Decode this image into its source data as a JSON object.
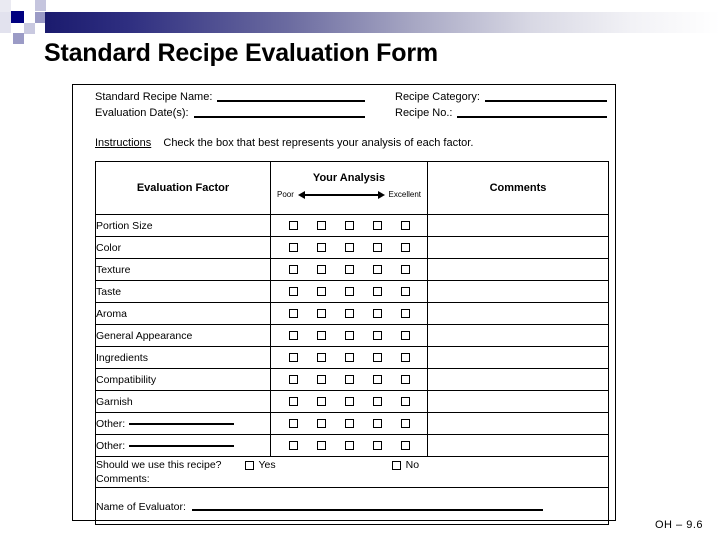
{
  "title": "Standard Recipe Evaluation Form",
  "decor": {
    "navy": "#000080",
    "lavender": "#b8b8d8",
    "pale": "#d8d8e8",
    "gradient_start": "#1b1b6e",
    "gradient_end": "#ffffff"
  },
  "top_fields": {
    "recipe_name_label": "Standard Recipe Name:",
    "evaluation_date_label": "Evaluation Date(s):",
    "recipe_category_label": "Recipe Category:",
    "recipe_no_label": "Recipe No.:"
  },
  "instructions": {
    "word": "Instructions",
    "text": "Check the box that best represents your analysis of each factor."
  },
  "table": {
    "headers": {
      "factor": "Evaluation Factor",
      "analysis": "Your Analysis",
      "scale_low": "Poor",
      "scale_high": "Excellent",
      "comments": "Comments"
    },
    "checkbox_count": 5,
    "rows": [
      {
        "label": "Portion Size",
        "has_rule": false
      },
      {
        "label": "Color",
        "has_rule": false
      },
      {
        "label": "Texture",
        "has_rule": false
      },
      {
        "label": "Taste",
        "has_rule": false
      },
      {
        "label": "Aroma",
        "has_rule": false
      },
      {
        "label": "General Appearance",
        "has_rule": false
      },
      {
        "label": "Ingredients",
        "has_rule": false
      },
      {
        "label": "Compatibility",
        "has_rule": false
      },
      {
        "label": "Garnish",
        "has_rule": false
      },
      {
        "label": "Other:",
        "has_rule": true
      },
      {
        "label": "Other:",
        "has_rule": true
      }
    ]
  },
  "recommend": {
    "question": "Should we use this recipe?",
    "yes_label": "Yes",
    "no_label": "No",
    "comments_label": "Comments:"
  },
  "evaluator": {
    "label": "Name of Evaluator:"
  },
  "footer": "OH – 9.6"
}
